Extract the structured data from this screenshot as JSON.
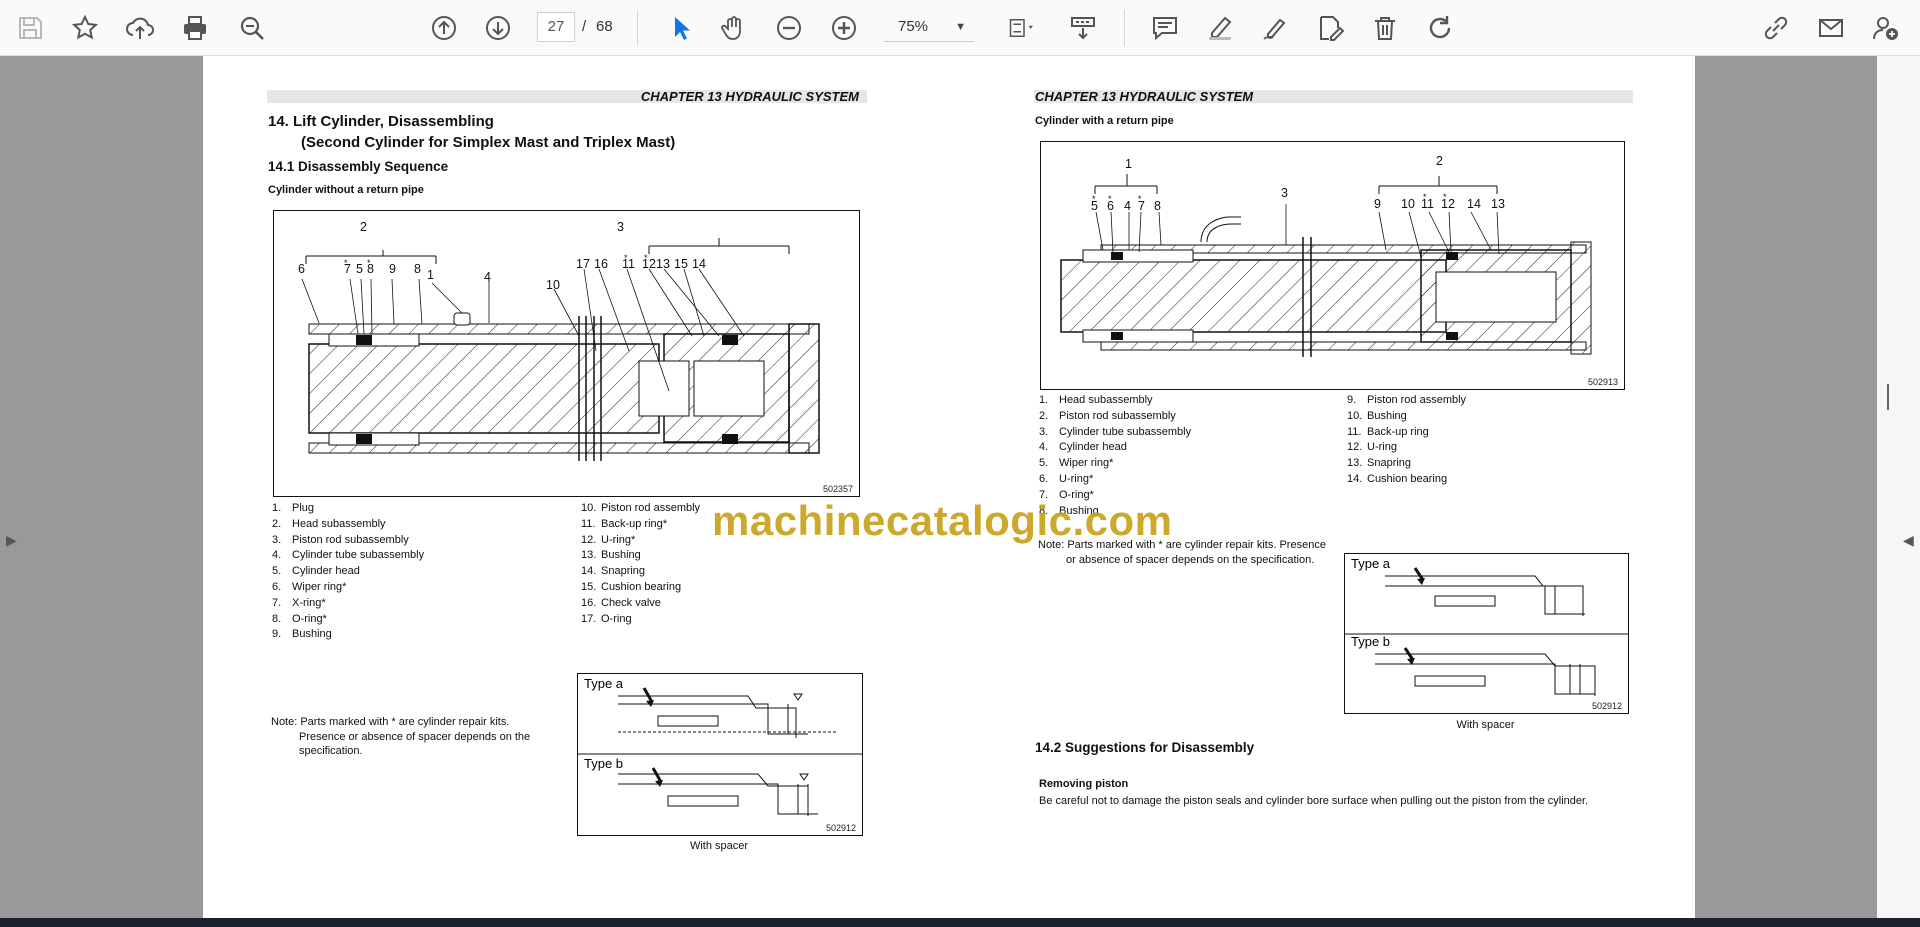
{
  "toolbar": {
    "page_current": "27",
    "page_sep": "/",
    "page_total": "68",
    "zoom": "75%",
    "icons": [
      "save-icon",
      "star-icon",
      "upload-cloud-icon",
      "print-icon",
      "zoom-search-icon",
      "page-up-icon",
      "page-down-icon",
      "select-cursor-icon",
      "hand-tool-icon",
      "zoom-out-icon",
      "zoom-in-icon",
      "fit-page-icon",
      "scroll-mode-icon",
      "comment-icon",
      "highlight-pen-icon",
      "sign-icon",
      "edit-pdf-icon",
      "delete-icon",
      "rotate-icon",
      "share-link-icon",
      "mail-icon",
      "add-user-icon"
    ],
    "accent": "#1473e6"
  },
  "left_page": {
    "header": "CHAPTER 13 HYDRAULIC SYSTEM",
    "title_line1": "14.  Lift Cylinder, Disassembling",
    "title_line2": "(Second Cylinder for Simplex Mast and Triplex Mast)",
    "subtitle": "14.1    Disassembly Sequence",
    "caption_top": "Cylinder without a return pipe",
    "diagram_id": "502357",
    "diagram_labels": [
      "2",
      "3",
      "6",
      "7",
      "5",
      "8",
      "9",
      "8",
      "1",
      "4",
      "10",
      "17",
      "16",
      "11",
      "12",
      "13",
      "15",
      "14"
    ],
    "legend_left": [
      {
        "n": "1.",
        "t": "Plug"
      },
      {
        "n": "2.",
        "t": "Head subassembly"
      },
      {
        "n": "3.",
        "t": "Piston rod subassembly"
      },
      {
        "n": "4.",
        "t": "Cylinder tube subassembly"
      },
      {
        "n": "5.",
        "t": "Cylinder head"
      },
      {
        "n": "6.",
        "t": "Wiper ring*"
      },
      {
        "n": "7.",
        "t": "X-ring*"
      },
      {
        "n": "8.",
        "t": "O-ring*"
      },
      {
        "n": "9.",
        "t": "Bushing"
      }
    ],
    "legend_right": [
      {
        "n": "10.",
        "t": "Piston rod assembly"
      },
      {
        "n": "11.",
        "t": "Back-up ring*"
      },
      {
        "n": "12.",
        "t": "U-ring*"
      },
      {
        "n": "13.",
        "t": "Bushing"
      },
      {
        "n": "14.",
        "t": "Snapring"
      },
      {
        "n": "15.",
        "t": "Cushion bearing"
      },
      {
        "n": "16.",
        "t": "Check valve"
      },
      {
        "n": "17.",
        "t": "O-ring"
      }
    ],
    "note_line1": "Note: Parts marked with * are cylinder repair kits.",
    "note_line2": "Presence or absence of spacer depends on the",
    "note_line3": "specification.",
    "inset_type_a": "Type a",
    "inset_type_b": "Type b",
    "inset_id": "502912",
    "inset_caption": "With spacer"
  },
  "right_page": {
    "header": "CHAPTER 13 HYDRAULIC SYSTEM",
    "caption_top": "Cylinder with a return pipe",
    "diagram_id": "502913",
    "diagram_labels": [
      "1",
      "2",
      "3",
      "5",
      "6",
      "4",
      "7",
      "8",
      "9",
      "10",
      "11",
      "12",
      "14",
      "13"
    ],
    "legend_left": [
      {
        "n": "1.",
        "t": "Head subassembly"
      },
      {
        "n": "2.",
        "t": "Piston rod subassembly"
      },
      {
        "n": "3.",
        "t": "Cylinder tube subassembly"
      },
      {
        "n": "4.",
        "t": "Cylinder head"
      },
      {
        "n": "5.",
        "t": "Wiper ring*"
      },
      {
        "n": "6.",
        "t": "U-ring*"
      },
      {
        "n": "7.",
        "t": "O-ring*"
      },
      {
        "n": "8.",
        "t": "Bushing"
      }
    ],
    "legend_right": [
      {
        "n": "9.",
        "t": "Piston rod assembly"
      },
      {
        "n": "10.",
        "t": "Bushing"
      },
      {
        "n": "11.",
        "t": "Back-up ring"
      },
      {
        "n": "12.",
        "t": "U-ring"
      },
      {
        "n": "13.",
        "t": "Snapring"
      },
      {
        "n": "14.",
        "t": "Cushion bearing"
      }
    ],
    "note_line1": "Note: Parts marked with * are cylinder repair kits. Presence",
    "note_line2": "or absence of spacer depends on the specification.",
    "inset_type_a": "Type a",
    "inset_type_b": "Type b",
    "inset_id": "502912",
    "inset_caption": "With spacer",
    "section_title": "14.2    Suggestions for Disassembly",
    "sub_heading": "Removing piston",
    "body": "Be careful not to damage the piston seals and cylinder bore surface when pulling out the piston from the cylinder."
  },
  "watermark": "machinecatalogic.com"
}
